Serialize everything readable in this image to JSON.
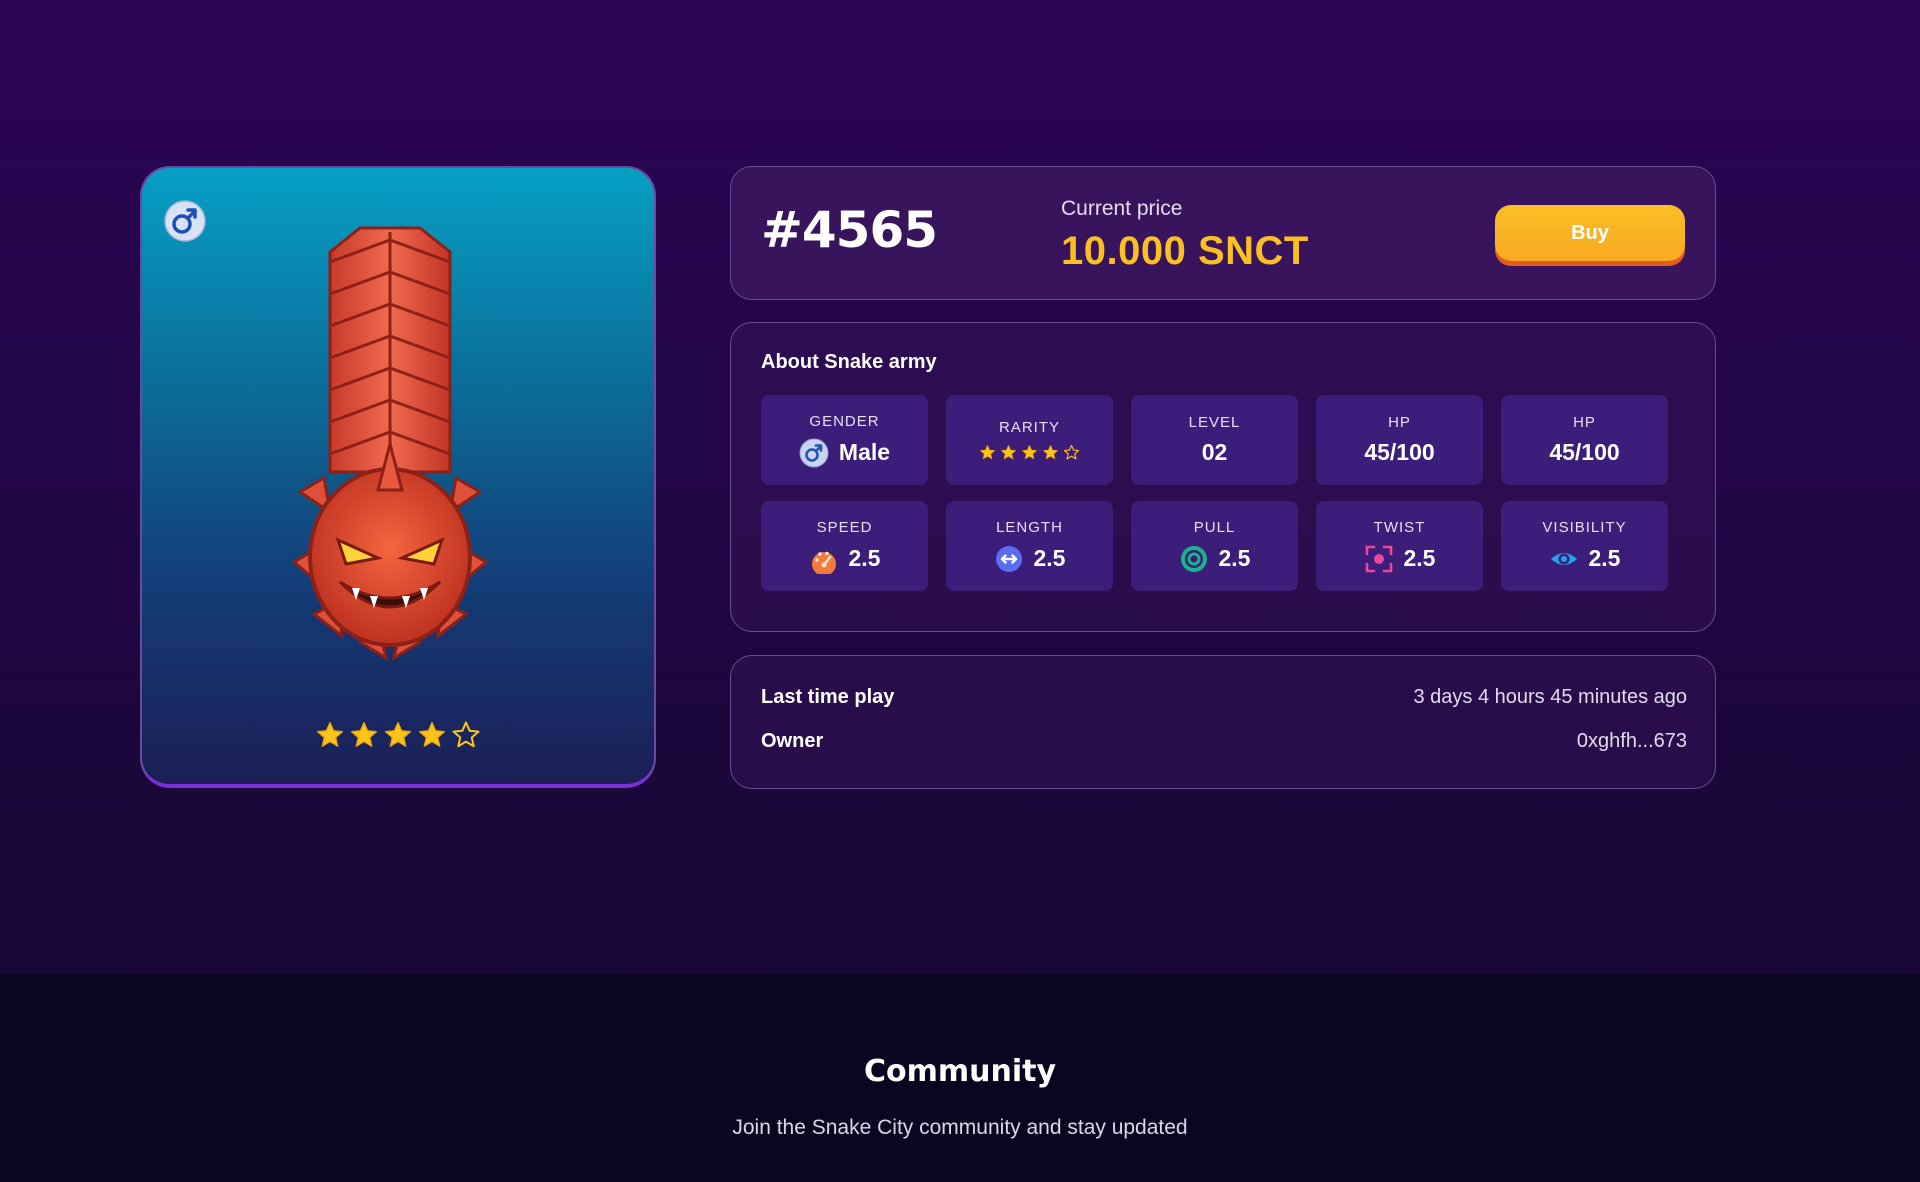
{
  "colors": {
    "background": "#2c0553",
    "accent": "#fbbf24",
    "buy_button": "#f7a823",
    "stat_tile": "#3d1d7a",
    "footer": "#0b0620"
  },
  "card": {
    "gender_icon": "male-icon",
    "rating": 4,
    "max_rating": 5
  },
  "listing": {
    "token_id": "#4565",
    "price_label": "Current price",
    "price_value": "10.000 SNCT",
    "buy_label": "Buy"
  },
  "about": {
    "title": "About Snake army",
    "stats": [
      {
        "label": "GENDER",
        "value": "Male",
        "icon": "male-icon"
      },
      {
        "label": "RARITY",
        "rating": 4,
        "max_rating": 5
      },
      {
        "label": "LEVEL",
        "value": "02"
      },
      {
        "label": "HP",
        "value": "45/100"
      },
      {
        "label": "HP",
        "value": "45/100"
      },
      {
        "label": "SPEED",
        "value": "2.5",
        "icon": "speedometer-icon"
      },
      {
        "label": "LENGTH",
        "value": "2.5",
        "icon": "arrows-horizontal-icon"
      },
      {
        "label": "PULL",
        "value": "2.5",
        "icon": "target-icon"
      },
      {
        "label": "TWIST",
        "value": "2.5",
        "icon": "focus-frame-icon"
      },
      {
        "label": "VISIBILITY",
        "value": "2.5",
        "icon": "eye-icon"
      }
    ]
  },
  "info": {
    "last_play_label": "Last time play",
    "last_play_value": "3 days  4 hours  45 minutes ago",
    "owner_label": "Owner",
    "owner_value": "0xghfh...673"
  },
  "footer": {
    "title": "Community",
    "subtitle": "Join the Snake City community and stay updated"
  }
}
